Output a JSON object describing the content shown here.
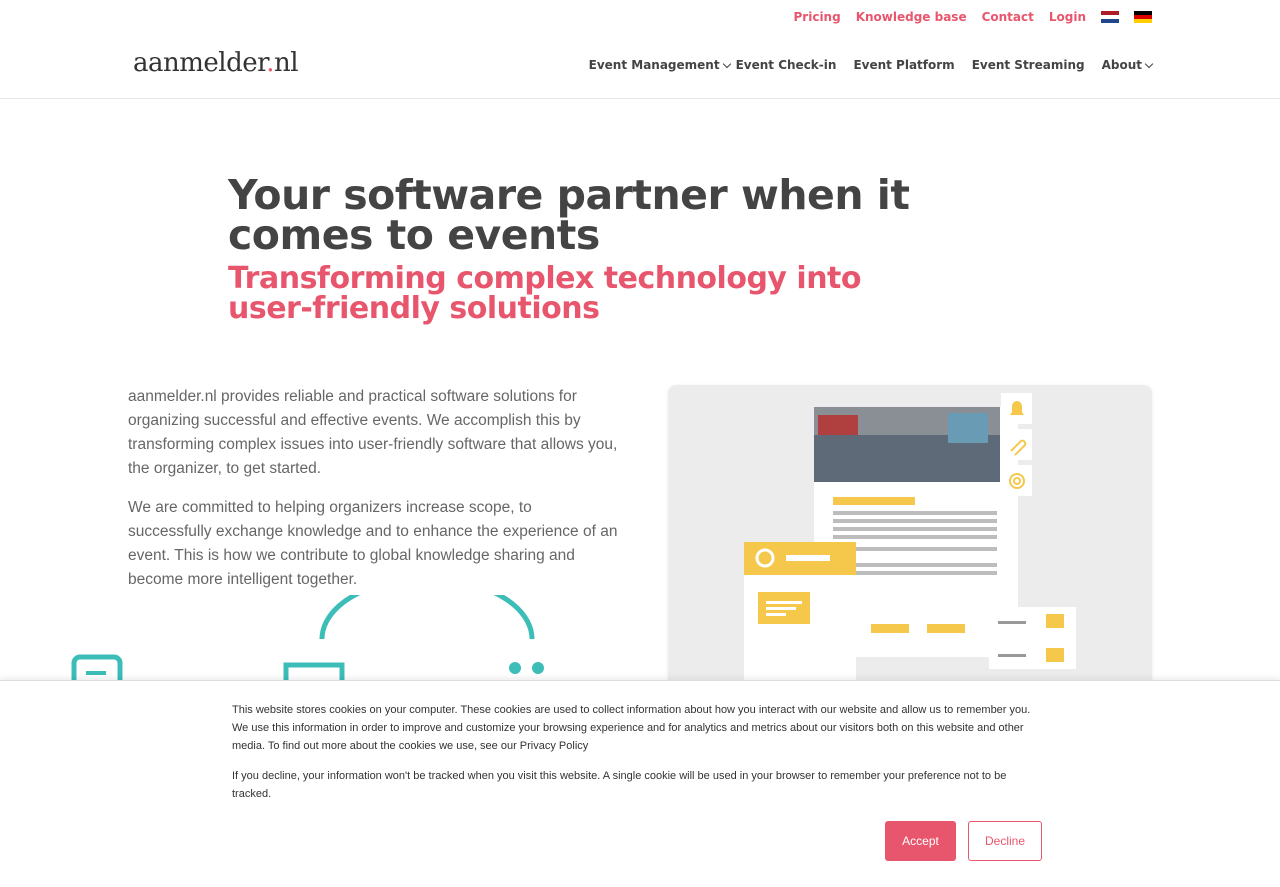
{
  "topnav": {
    "links": [
      "Pricing",
      "Knowledge base",
      "Contact",
      "Login"
    ],
    "flags": [
      "nl-flag-icon",
      "de-flag-icon"
    ]
  },
  "brand": {
    "logo_text": "aanmelder",
    "logo_dot": ".",
    "logo_tld": "nl"
  },
  "mainnav": {
    "items": [
      {
        "label": "Event Management",
        "dropdown": true
      },
      {
        "label": "Event Check-in",
        "dropdown": false
      },
      {
        "label": "Event Platform",
        "dropdown": false
      },
      {
        "label": "Event Streaming",
        "dropdown": false
      },
      {
        "label": "About",
        "dropdown": true
      }
    ]
  },
  "hero": {
    "title": "Your software partner when it comes to events",
    "subtitle": "Transforming complex technology into user-friendly solutions",
    "paragraph1": "aanmelder.nl provides reliable and practical software solutions for organizing successful and effective events. We accomplish this by transforming complex issues into user-friendly software that allows you, the organizer, to get started.",
    "paragraph2": "We are committed to helping organizers increase scope, to successfully exchange knowledge and to enhance the experience of an event. This is how we contribute to global knowledge sharing and become more intelligent together."
  },
  "cookie": {
    "text1": "This website stores cookies on your computer. These cookies are used to collect information about how you interact with our website and allow us to remember you. We use this information in order to improve and customize your browsing experience and for analytics and metrics about our visitors both on this website and other media. To find out more about the cookies we use, see our Privacy Policy",
    "text2": "If you decline, your information won't be tracked when you visit this website. A single cookie will be used in your browser to remember your preference not to be tracked.",
    "accept_label": "Accept",
    "decline_label": "Decline"
  },
  "colors": {
    "accent": "#e8566d",
    "yellow": "#f5c84c",
    "teal": "#3dbdb8"
  }
}
